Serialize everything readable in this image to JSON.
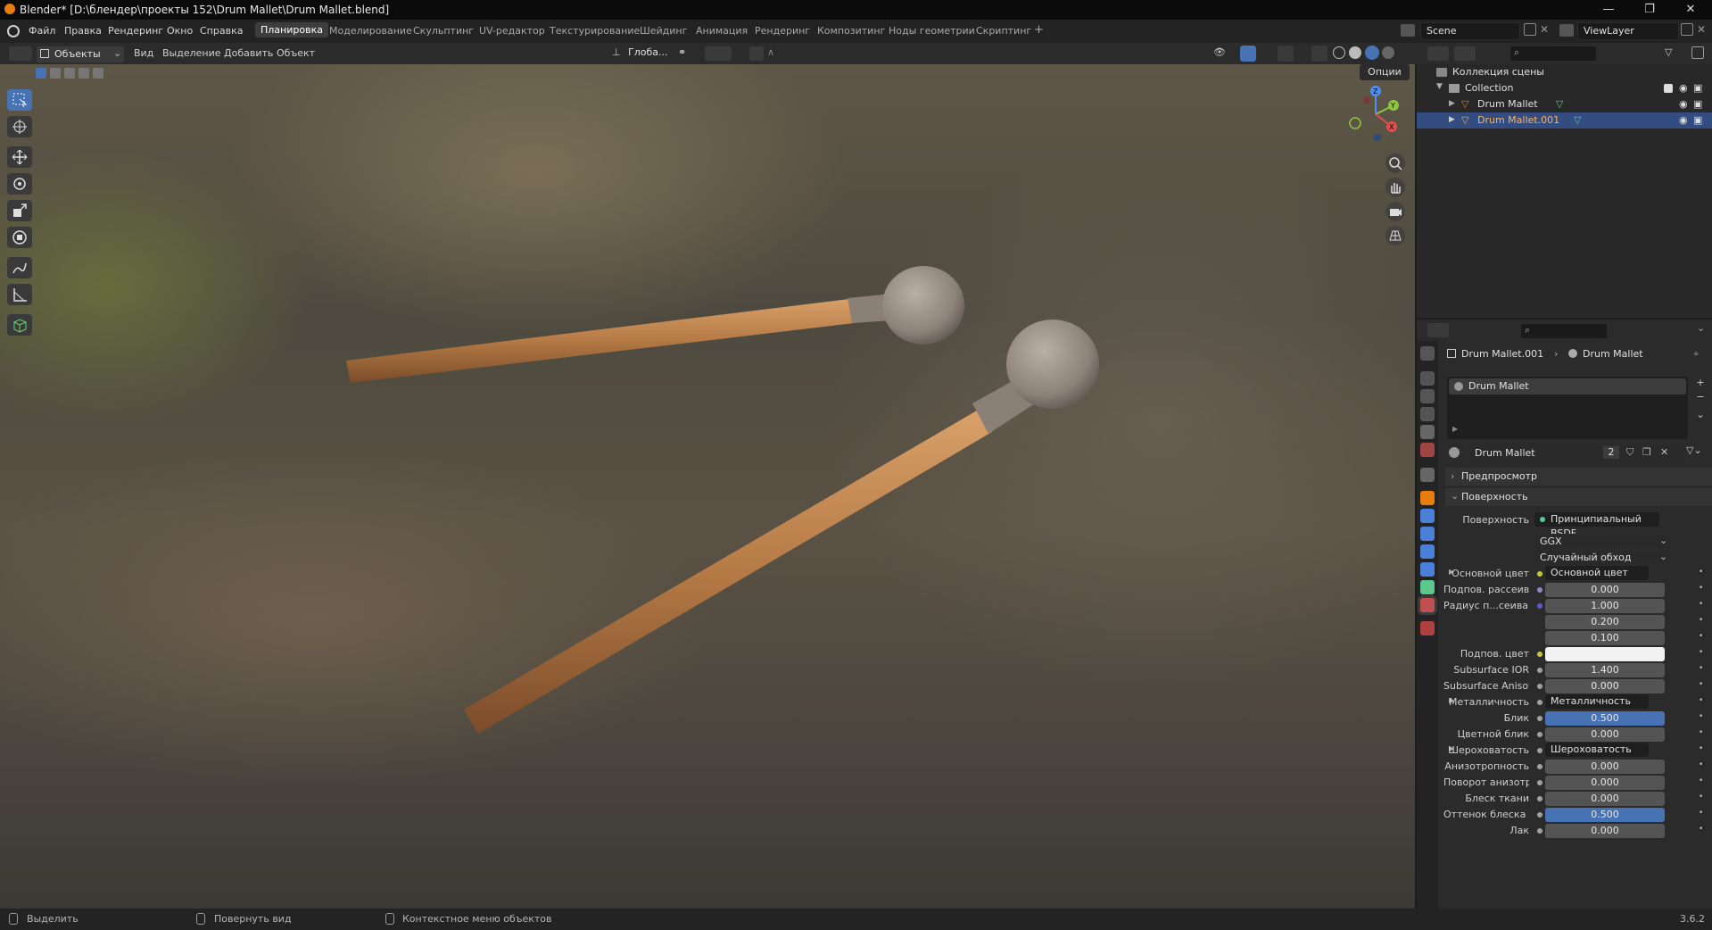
{
  "window": {
    "title": "Blender* [D:\\блендер\\проекты 152\\Drum Mallet\\Drum Mallet.blend]",
    "minimize": "—",
    "maximize": "❐",
    "close": "✕"
  },
  "menu": {
    "items": [
      "Файл",
      "Правка",
      "Рендеринг",
      "Окно",
      "Справка"
    ]
  },
  "workspaces": {
    "tabs": [
      "Планировка",
      "Моделирование",
      "Скульптинг",
      "UV-редактор",
      "Текстурирование",
      "Шейдинг",
      "Анимация",
      "Рендеринг",
      "Композитинг",
      "Ноды геометрии",
      "Скриптинг"
    ],
    "add": "+",
    "active": "Планировка"
  },
  "scene": {
    "scene_name": "Scene",
    "view_layer": "ViewLayer"
  },
  "viewport_header": {
    "mode": "Объекты",
    "menus": [
      "Вид",
      "Выделение",
      "Добавить",
      "Объект"
    ],
    "orientation": "Глоба...",
    "options": "Опции"
  },
  "outliner": {
    "root": "Коллекция сцены",
    "collection": "Collection",
    "objects": [
      {
        "name": "Drum Mallet",
        "selected": false
      },
      {
        "name": "Drum Mallet.001",
        "selected": true
      }
    ]
  },
  "properties": {
    "breadcrumb_object": "Drum Mallet.001",
    "breadcrumb_material": "Drum Mallet",
    "slot_name": "Drum Mallet",
    "material_name": "Drum Mallet",
    "user_count": "2",
    "panel_preview": "Предпросмотр",
    "panel_surface": "Поверхность",
    "surface_label": "Поверхность",
    "surface_value": "Принципиальный BSDF",
    "distribution": "GGX",
    "subsurface_method": "Случайный обход",
    "rows": [
      {
        "label": "Основной цвет",
        "value": "Основной цвет",
        "kind": "node",
        "expander": true,
        "dot": "#c8c83a"
      },
      {
        "label": "Подпов. рассеива...",
        "value": "0.000",
        "kind": "num",
        "dot": "#8a8ac8"
      },
      {
        "label": "Радиус п...сеивания",
        "value": "1.000",
        "kind": "num",
        "dot": "#5a5ad0"
      },
      {
        "label": "",
        "value": "0.200",
        "kind": "num",
        "dot": ""
      },
      {
        "label": "",
        "value": "0.100",
        "kind": "num",
        "dot": ""
      },
      {
        "label": "Подпов. цвет",
        "value": "",
        "kind": "color",
        "dot": "#c8c83a"
      },
      {
        "label": "Subsurface IOR",
        "value": "1.400",
        "kind": "num",
        "dot": "#a0a0a0"
      },
      {
        "label": "Subsurface Anisotr...",
        "value": "0.000",
        "kind": "num",
        "dot": "#a0a0a0"
      },
      {
        "label": "Металличность",
        "value": "Металличность",
        "kind": "node",
        "expander": true,
        "dot": "#a0a0a0"
      },
      {
        "label": "Блик",
        "value": "0.500",
        "kind": "blue",
        "dot": "#a0a0a0"
      },
      {
        "label": "Цветной блик",
        "value": "0.000",
        "kind": "num",
        "dot": "#a0a0a0"
      },
      {
        "label": "Шероховатость",
        "value": "Шероховатость",
        "kind": "node",
        "expander": true,
        "dot": "#a0a0a0"
      },
      {
        "label": "Анизотропность",
        "value": "0.000",
        "kind": "num",
        "dot": "#a0a0a0"
      },
      {
        "label": "Поворот анизотро...",
        "value": "0.000",
        "kind": "num",
        "dot": "#a0a0a0"
      },
      {
        "label": "Блеск ткани",
        "value": "0.000",
        "kind": "num",
        "dot": "#a0a0a0"
      },
      {
        "label": "Оттенок блеска тк...",
        "value": "0.500",
        "kind": "blue",
        "dot": "#a0a0a0"
      },
      {
        "label": "Лак",
        "value": "0.000",
        "kind": "num",
        "dot": "#a0a0a0"
      }
    ]
  },
  "statusbar": {
    "select": "Выделить",
    "rotate": "Повернуть вид",
    "context": "Контекстное меню объектов",
    "version": "3.6.2"
  },
  "colors": {
    "accent": "#4772b3",
    "selected_row": "#334d80",
    "mesh_icon": "#e87d0d",
    "data_icon": "#5cc88e"
  }
}
